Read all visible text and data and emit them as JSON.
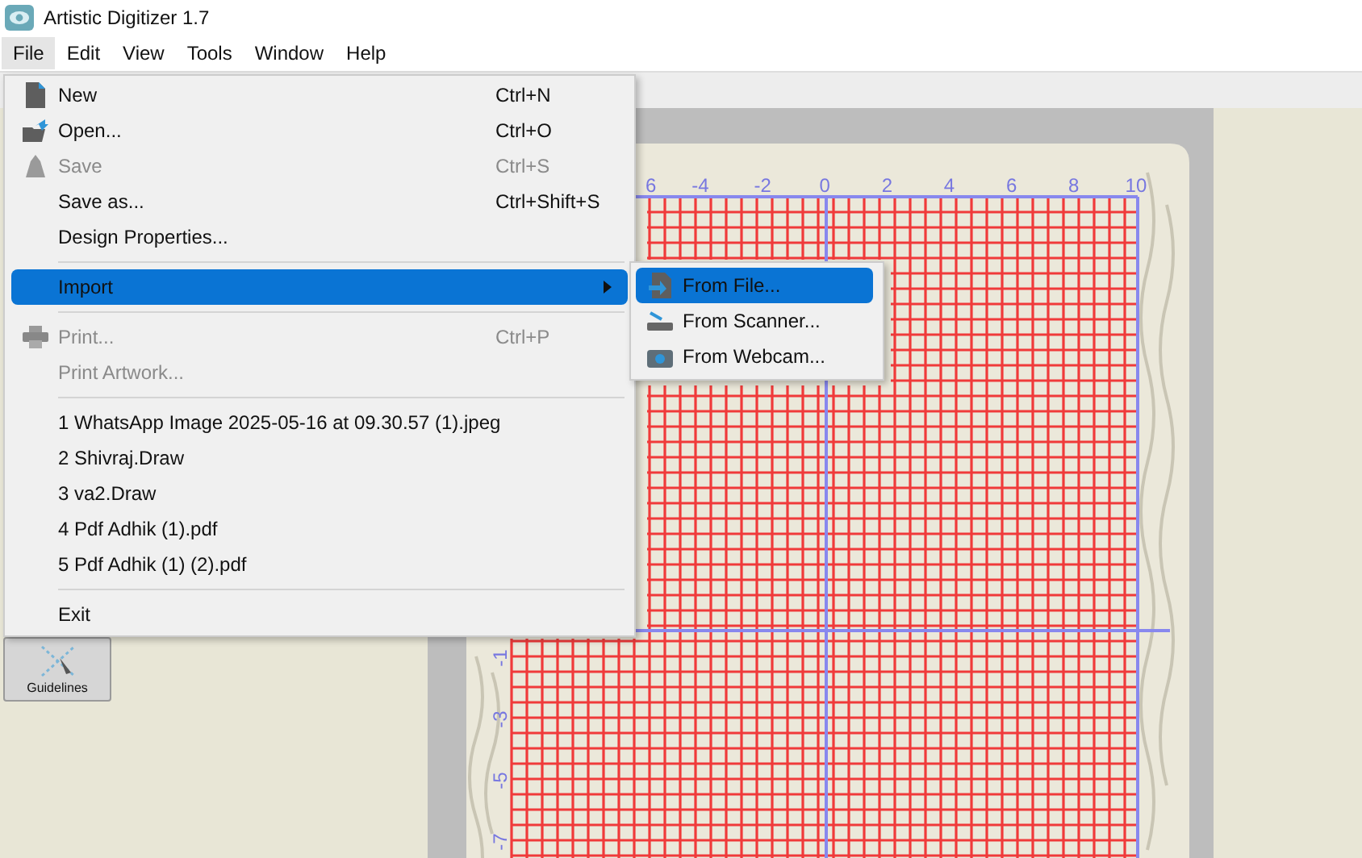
{
  "window": {
    "title": "Artistic Digitizer 1.7"
  },
  "menu_bar": [
    {
      "label": "File",
      "selected": true
    },
    {
      "label": "Edit",
      "selected": false
    },
    {
      "label": "View",
      "selected": false
    },
    {
      "label": "Tools",
      "selected": false
    },
    {
      "label": "Window",
      "selected": false
    },
    {
      "label": "Help",
      "selected": false
    }
  ],
  "file_menu": [
    {
      "kind": "item",
      "label": "New",
      "shortcut": "Ctrl+N",
      "disabled": false,
      "selected": false
    },
    {
      "kind": "item",
      "label": "Open...",
      "shortcut": "Ctrl+O",
      "disabled": false,
      "selected": false
    },
    {
      "kind": "item",
      "label": "Save",
      "shortcut": "Ctrl+S",
      "disabled": true,
      "selected": false
    },
    {
      "kind": "item",
      "label": "Save as...",
      "shortcut": "Ctrl+Shift+S",
      "disabled": false,
      "selected": false
    },
    {
      "kind": "item",
      "label": "Design Properties...",
      "disabled": false,
      "selected": false
    },
    {
      "kind": "separator"
    },
    {
      "kind": "submenu",
      "label": "Import",
      "disabled": false,
      "selected": true
    },
    {
      "kind": "separator"
    },
    {
      "kind": "item",
      "label": "Print...",
      "shortcut": "Ctrl+P",
      "disabled": true,
      "selected": false
    },
    {
      "kind": "item",
      "label": "Print Artwork...",
      "disabled": true,
      "selected": false
    },
    {
      "kind": "separator"
    },
    {
      "kind": "item",
      "label": "1 WhatsApp Image 2025-05-16 at 09.30.57 (1).jpeg",
      "disabled": false,
      "selected": false
    },
    {
      "kind": "item",
      "label": "2 Shivraj.Draw",
      "disabled": false,
      "selected": false
    },
    {
      "kind": "item",
      "label": "3 va2.Draw",
      "disabled": false,
      "selected": false
    },
    {
      "kind": "item",
      "label": "4 Pdf Adhik (1).pdf",
      "disabled": false,
      "selected": false
    },
    {
      "kind": "item",
      "label": "5 Pdf Adhik (1) (2).pdf",
      "disabled": false,
      "selected": false
    },
    {
      "kind": "separator"
    },
    {
      "kind": "item",
      "label": "Exit",
      "disabled": false,
      "selected": false
    }
  ],
  "import_submenu": [
    {
      "label": "From File...",
      "selected": true
    },
    {
      "label": "From Scanner...",
      "selected": false
    },
    {
      "label": "From Webcam...",
      "selected": false
    }
  ],
  "left_panel": {
    "buttons": [
      "Guidelines"
    ]
  },
  "canvas": {
    "top_ruler_labels": [
      "6",
      "-4",
      "-2",
      "0",
      "2",
      "4",
      "6",
      "8",
      "10"
    ],
    "left_ruler_labels": [
      "-1",
      "-3",
      "-5",
      "-7"
    ]
  }
}
